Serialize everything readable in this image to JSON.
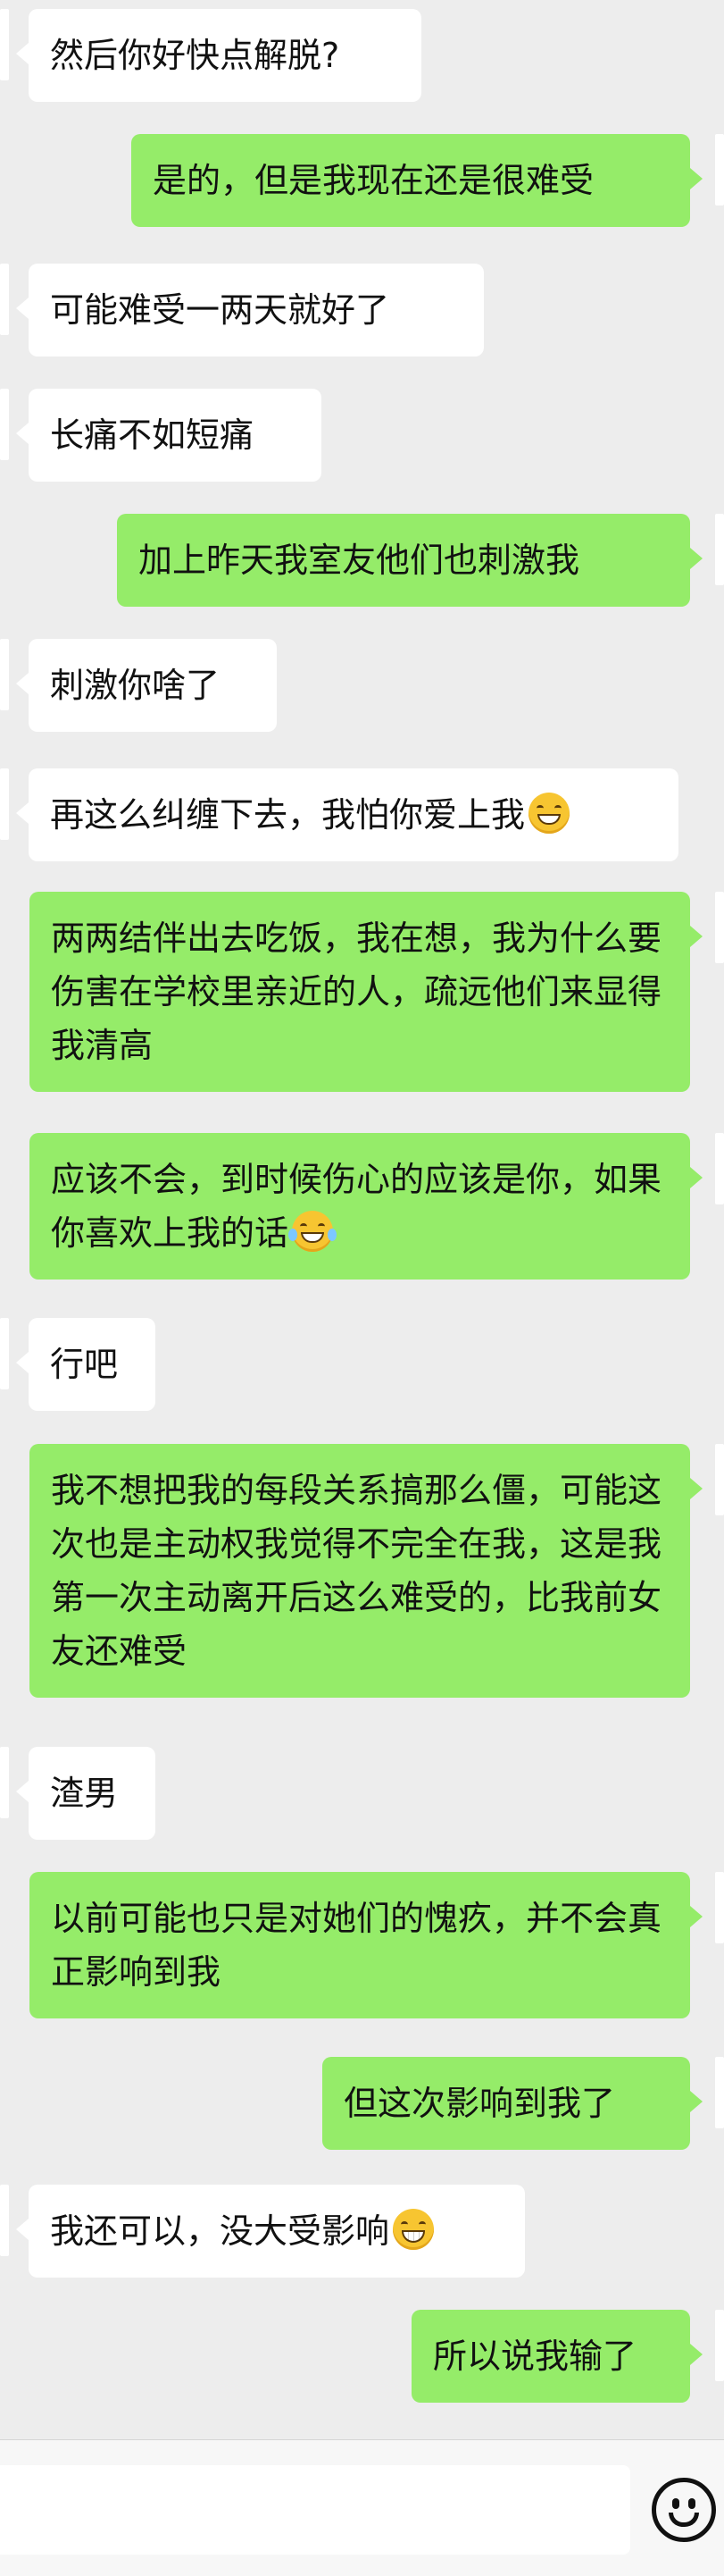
{
  "chat": {
    "messages": [
      {
        "side": "left",
        "text": "然后你好快点解脱?"
      },
      {
        "side": "right",
        "text": "是的，但是我现在还是很难受"
      },
      {
        "side": "left",
        "text": "可能难受一两天就好了"
      },
      {
        "side": "left",
        "text": "长痛不如短痛"
      },
      {
        "side": "right",
        "text": "加上昨天我室友他们也刺激我"
      },
      {
        "side": "left",
        "text": "刺激你啥了"
      },
      {
        "side": "left",
        "text": "再这么纠缠下去，我怕你爱上我",
        "emoji": "smirk"
      },
      {
        "side": "right",
        "text": "两两结伴出去吃饭，我在想，我为什么要伤害在学校里亲近的人，疏远他们来显得我清高"
      },
      {
        "side": "right",
        "text": "应该不会，到时候伤心的应该是你，如果你喜欢上我的话",
        "emoji": "tears-of-joy"
      },
      {
        "side": "left",
        "text": "行吧"
      },
      {
        "side": "right",
        "text": "我不想把我的每段关系搞那么僵，可能这次也是主动权我觉得不完全在我，这是我第一次主动离开后这么难受的，比我前女友还难受"
      },
      {
        "side": "left",
        "text": "渣男"
      },
      {
        "side": "right",
        "text": "以前可能也只是对她们的愧疚，并不会真正影响到我"
      },
      {
        "side": "right",
        "text": "但这次影响到我了"
      },
      {
        "side": "left",
        "text": "我还可以，没大受影响",
        "emoji": "grin"
      },
      {
        "side": "right",
        "text": "所以说我输了"
      }
    ]
  },
  "input_bar": {
    "placeholder": "",
    "emoji_icon": "smiley-face-icon"
  },
  "colors": {
    "background": "#ededed",
    "incoming_bubble": "#ffffff",
    "outgoing_bubble": "#95ec69"
  }
}
